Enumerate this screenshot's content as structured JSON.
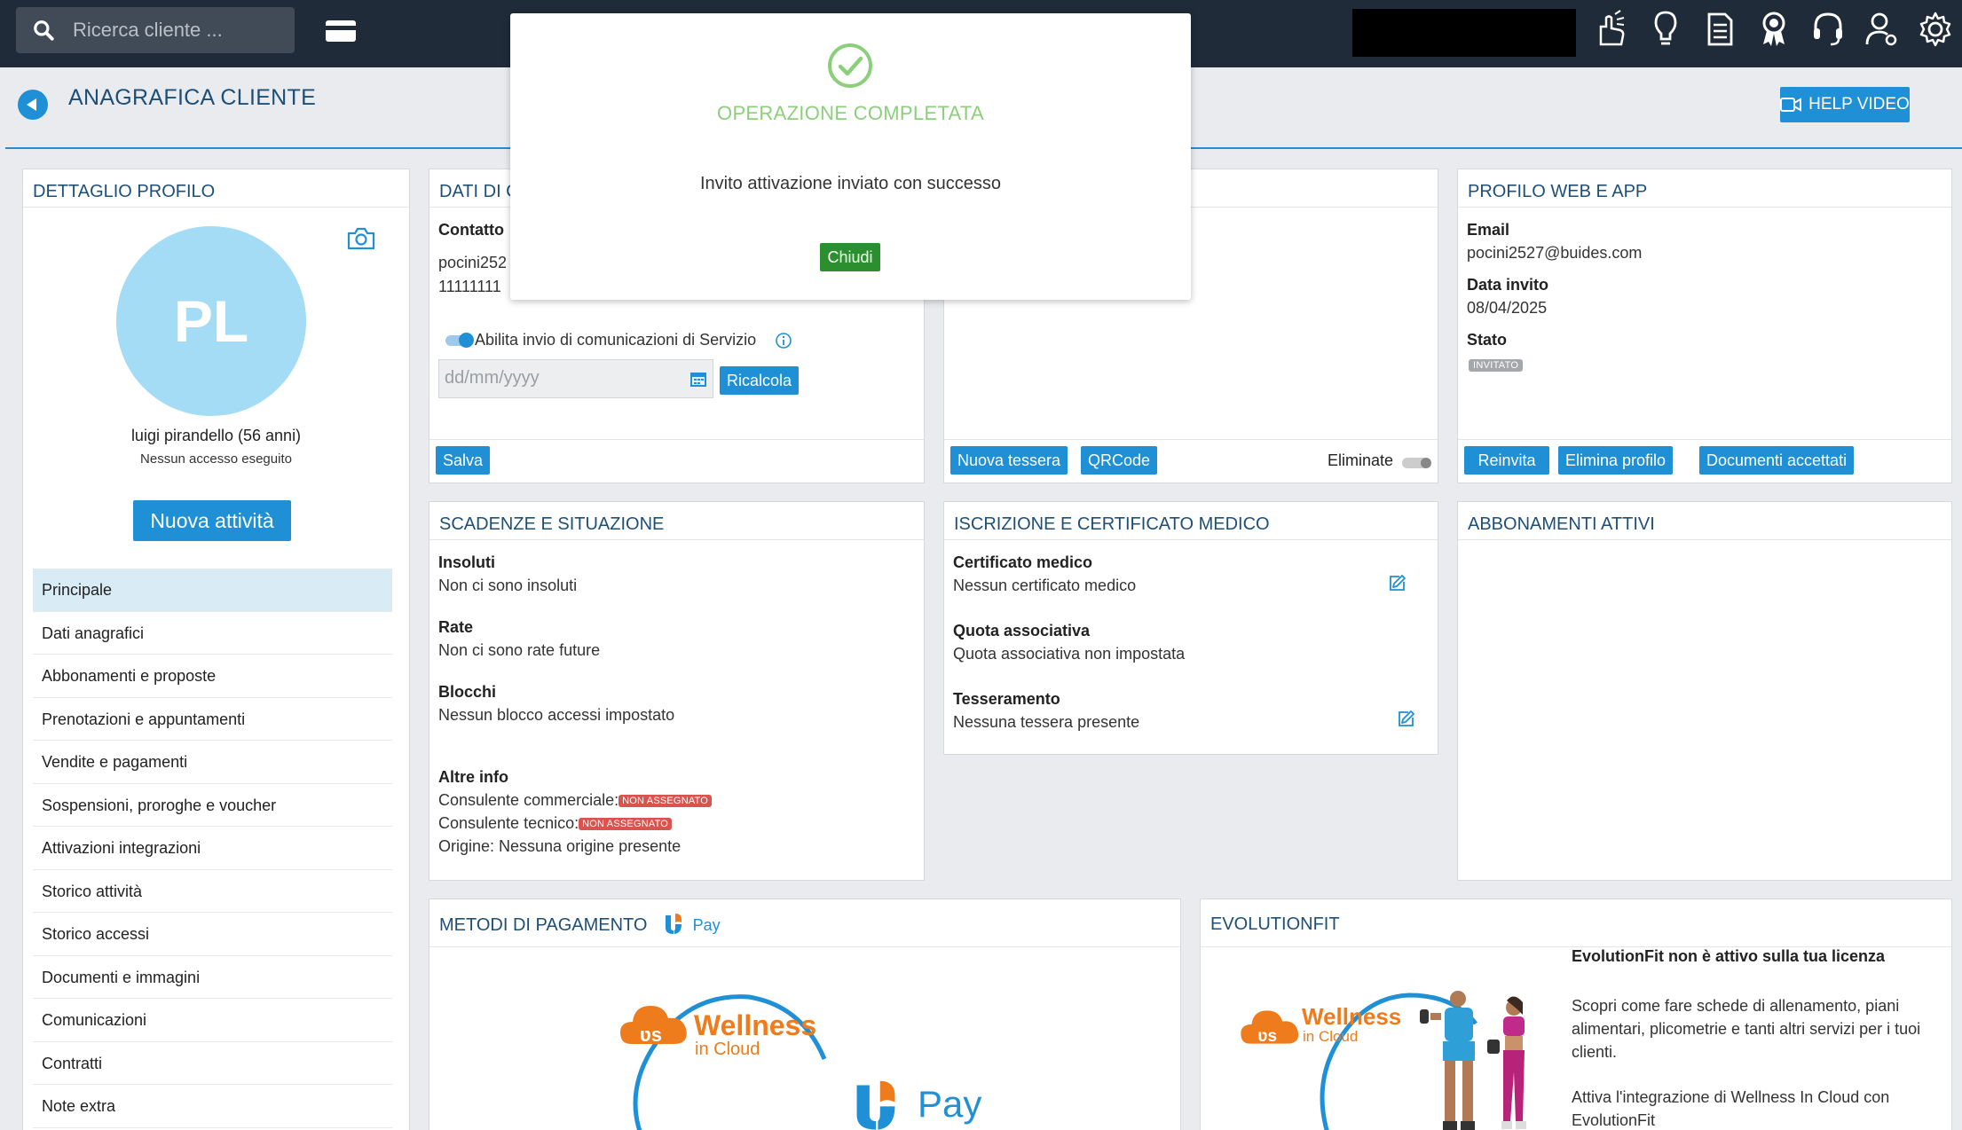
{
  "topbar": {
    "search_placeholder": "Ricerca cliente ...",
    "icons": [
      "card-icon",
      "hand-pointer-icon",
      "lightbulb-icon",
      "document-icon",
      "award-icon",
      "headset-icon",
      "user-settings-icon",
      "gear-icon"
    ]
  },
  "header": {
    "title": "ANAGRAFICA CLIENTE",
    "help_label": "HELP VIDEO"
  },
  "profile": {
    "panel_title": "DETTAGLIO PROFILO",
    "initials": "PL",
    "name": "luigi pirandello (56 anni)",
    "access": "Nessun accesso eseguito",
    "new_activity": "Nuova attività",
    "menu": [
      "Principale",
      "Dati anagrafici",
      "Abbonamenti e proposte",
      "Prenotazioni e appuntamenti",
      "Vendite e pagamenti",
      "Sospensioni, proroghe e voucher",
      "Attivazioni integrazioni",
      "Storico attività",
      "Storico accessi",
      "Documenti e immagini",
      "Comunicazioni",
      "Contratti",
      "Note extra"
    ]
  },
  "contact": {
    "panel_title": "DATI DI C",
    "label": "Contatto",
    "line1": "pocini252",
    "line2": "11111111",
    "service_label": "Abilita invio di comunicazioni di Servizio",
    "date_placeholder": "dd/mm/yyyy",
    "recalc": "Ricalcola",
    "save": "Salva"
  },
  "cards": {
    "new_card": "Nuova tessera",
    "qrcode": "QRCode",
    "deleted": "Eliminate"
  },
  "web": {
    "panel_title": "PROFILO WEB E APP",
    "email_label": "Email",
    "email": "pocini2527@buides.com",
    "invite_label": "Data invito",
    "invite_date": "08/04/2025",
    "status_label": "Stato",
    "status": "INVITATO",
    "resend": "Reinvita",
    "delete": "Elimina profilo",
    "docs": "Documenti accettati"
  },
  "deadlines": {
    "panel_title": "SCADENZE E SITUAZIONE",
    "unpaid_label": "Insoluti",
    "unpaid": "Non ci sono insoluti",
    "rates_label": "Rate",
    "rates": "Non ci sono rate future",
    "blocks_label": "Blocchi",
    "blocks": "Nessun blocco accessi impostato",
    "other_label": "Altre info",
    "commercial": "Consulente commerciale:",
    "technical": "Consulente tecnico:",
    "not_assigned": "NON ASSEGNATO",
    "origin": "Origine: Nessuna origine presente"
  },
  "medical": {
    "panel_title": "ISCRIZIONE E CERTIFICATO MEDICO",
    "cert_label": "Certificato medico",
    "cert": "Nessun certificato medico",
    "fee_label": "Quota associativa",
    "fee": "Quota associativa non impostata",
    "card_label": "Tesseramento",
    "card": "Nessuna tessera presente"
  },
  "subscriptions": {
    "panel_title": "ABBONAMENTI ATTIVI"
  },
  "payments": {
    "panel_title": "METODI DI PAGAMENTO",
    "pay_label": "Pay",
    "brand_name": "Wellness",
    "brand_sub": "in Cloud",
    "big_pay": "Pay"
  },
  "evolution": {
    "panel_title": "EVOLUTIONFIT",
    "heading": "EvolutionFit non è attivo sulla tua licenza",
    "p1": "Scopri come fare schede di allenamento, piani alimentari, plicometrie e tanti altri servizi per i tuoi clienti.",
    "p2": "Attiva l'integrazione di Wellness In Cloud con EvolutionFit",
    "brand_name": "Wellness",
    "brand_sub": "in Cloud"
  },
  "modal": {
    "title": "OPERAZIONE COMPLETATA",
    "message": "Invito attivazione inviato con successo",
    "close": "Chiudi"
  },
  "colors": {
    "accent": "#1f8fd6",
    "topbar": "#1f2b38",
    "success": "#8ccf7a",
    "danger": "#d9534f",
    "brand_orange": "#ee7b1c"
  }
}
